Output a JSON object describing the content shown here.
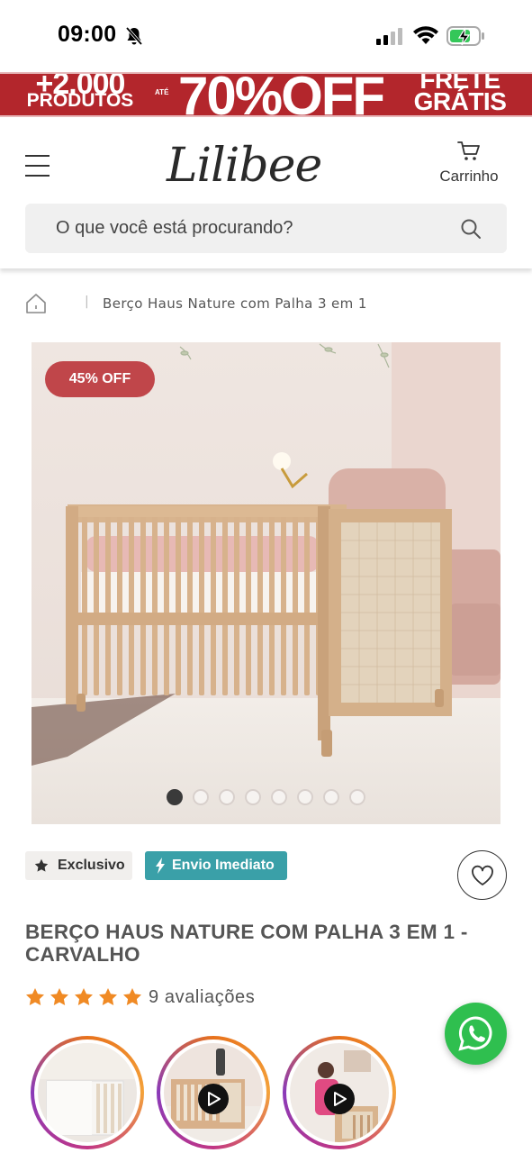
{
  "status_bar": {
    "time": "09:00"
  },
  "promo_banner": {
    "left_big": "+2.000",
    "left_small": "PRODUTOS",
    "ate": "ATÉ",
    "headline": "70%OFF",
    "right_line1": "FRETE",
    "right_line2": "GRÁTIS",
    "background": "#b3262c"
  },
  "header": {
    "logo": "Lilibee",
    "cart_label": "Carrinho",
    "search_placeholder": "O que você está procurando?"
  },
  "breadcrumb": {
    "separator": "|",
    "current": "Berço Haus Nature com Palha 3 em 1"
  },
  "gallery": {
    "discount_badge": "45% OFF",
    "badge_color": "#c0464a",
    "dot_count": 8,
    "active_dot": 0
  },
  "tags": {
    "exclusive": "Exclusivo",
    "express": "Envio Imediato",
    "express_color": "#3aa0a8"
  },
  "product": {
    "title": "BERÇO HAUS NATURE COM PALHA 3 EM 1 - CARVALHO",
    "rating": 5,
    "reviews": "9 avaliações",
    "star_color": "#f08a24"
  },
  "stories": [
    {
      "has_play": false
    },
    {
      "has_play": true
    },
    {
      "has_play": true
    }
  ],
  "whatsapp_color": "#2fbf4f"
}
